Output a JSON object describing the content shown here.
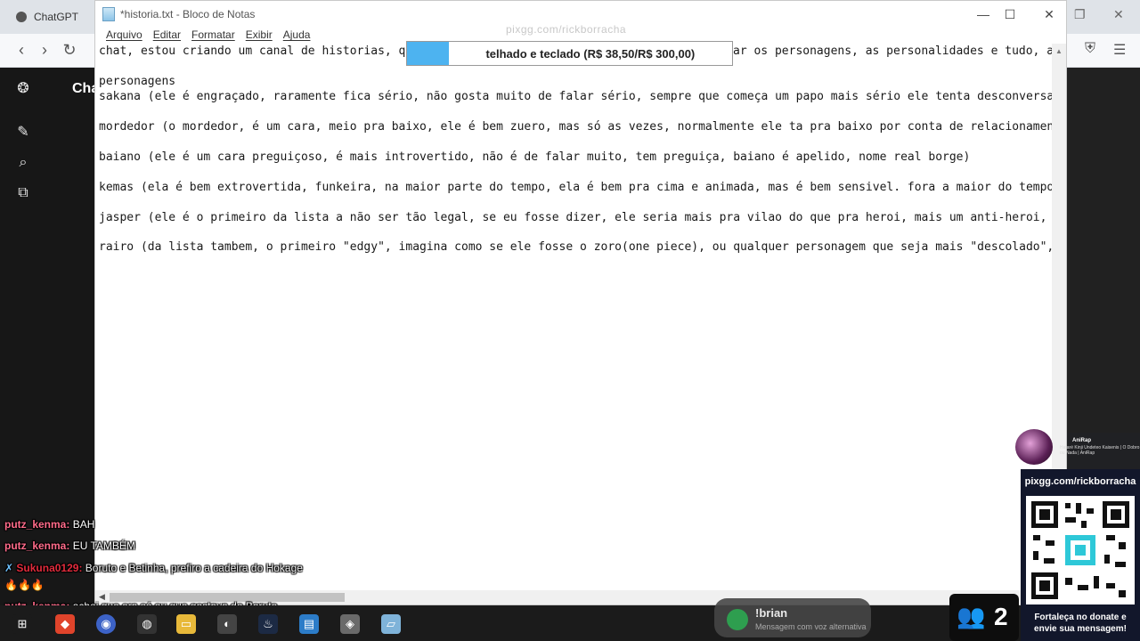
{
  "browser": {
    "tab_title": "ChatGPT"
  },
  "chatgpt": {
    "title": "Cha"
  },
  "notepad": {
    "title": "*historia.txt - Bloco de Notas",
    "menu": [
      "Arquivo",
      "Editar",
      "Formatar",
      "Exibir",
      "Ajuda"
    ],
    "lines": [
      "chat, estou criando um canal de historias, que",
      "personagens",
      "sakana (ele é engraçado, raramente fica sério, não gosta muito de falar sério, sempre que começa um papo mais sério ele tenta desconversar pra",
      "mordedor (o mordedor, é um cara, meio pra baixo, ele é bem zuero, mas só as vezes, normalmente ele ta pra baixo por conta de relacionamentos pa",
      "baiano (ele é um cara preguiçoso, é mais introvertido, não é de falar muito, tem preguiça, baiano é apelido, nome real borge)",
      "kemas (ela é bem extrovertida, funkeira, na maior parte do tempo, ela é bem pra cima e animada, mas é bem sensivel. fora a maior do tempo, as v",
      "jasper (ele é o primeiro da lista a não ser tão legal, se eu fosse dizer, ele seria mais pra vilao do que pra heroi, mais um anti-heroi, ele nc",
      "rairo (da lista tambem, o primeiro \"edgy\", imagina como se ele fosse o zoro(one piece), ou qualquer personagem que seja mais \"descolado\", ele é"
    ],
    "line1_tail": "ar os personagens, as personalidades e tudo, ai"
  },
  "donation": {
    "goal_text": "telhado e teclado (R$ 38,50/R$ 300,00)",
    "goal_progress": 0.128,
    "url_watermark": "pixgg.com/rickborracha"
  },
  "chat": [
    {
      "user": "putz_kenma:",
      "text": "BAH"
    },
    {
      "user": "putz_kenma:",
      "text": "EU TAMBÉM"
    },
    {
      "user": "Sukuna0129:",
      "text": "Boruto e Betinha, prefiro a cadeira do Hokage"
    },
    {
      "user": "putz_kenma:",
      "text": "achei que era só eu que gostava de Boruto"
    },
    {
      "user": "putz_kenma:",
      "text": ""
    }
  ],
  "voice_alert": {
    "name": "!brian",
    "subtitle": "Mensagem com voz alternativa"
  },
  "viewers": {
    "count": "2"
  },
  "song": {
    "title": "AniRap",
    "subtitle": "Hataré Kinji Undeteo Kaisenis | O Dobro ou Nada | AniRap"
  },
  "qr_panel": {
    "url": "pixgg.com/rickborracha",
    "caption_line1": "Fortaleça no donate e",
    "caption_line2": "envie sua mensagem!"
  },
  "colors": {
    "accent_blue": "#4db3f0",
    "chat_username": "#ff6b8a",
    "taskbar": "#1b1b1b"
  }
}
